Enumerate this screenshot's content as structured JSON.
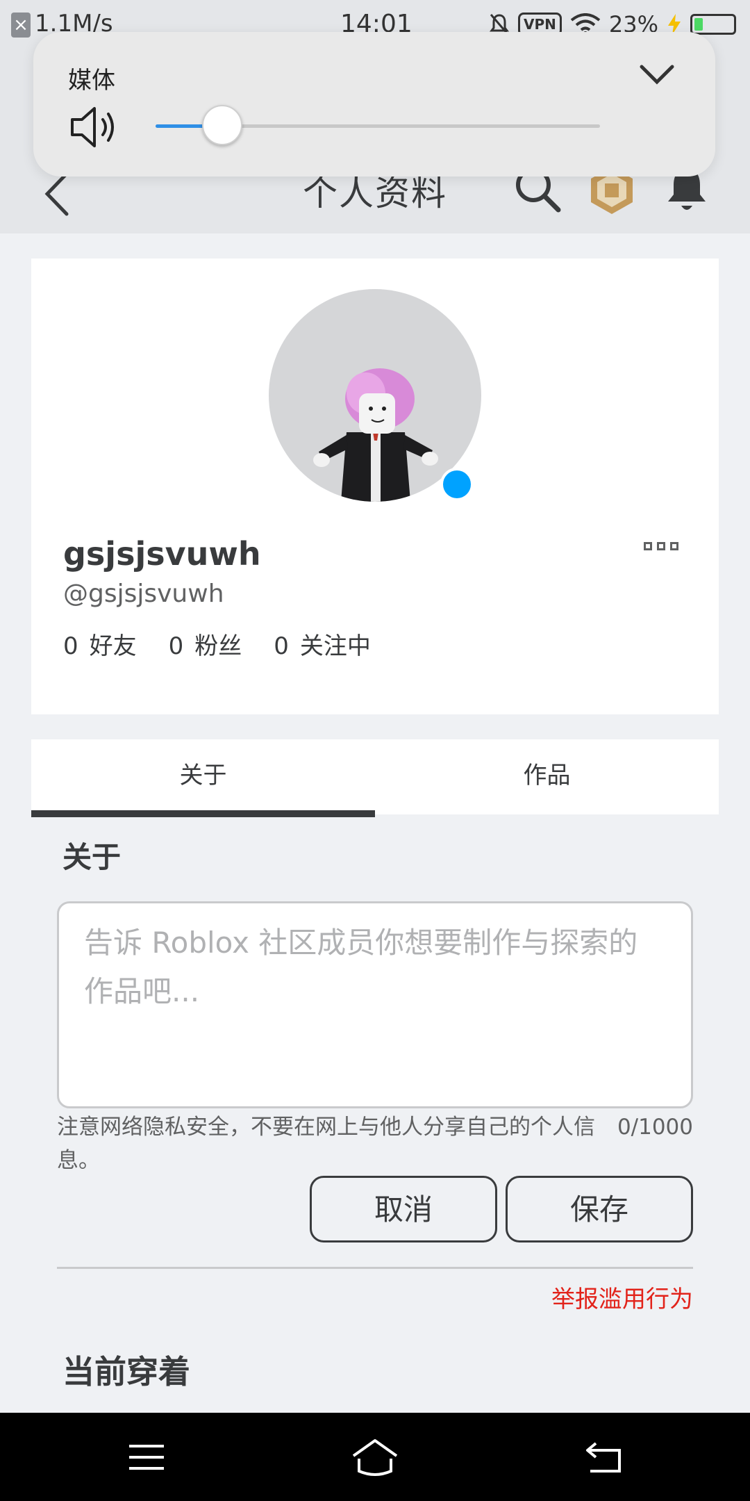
{
  "status_bar": {
    "speed": "1.1M/s",
    "time": "14:01",
    "vpn_label": "VPN",
    "battery_percent": "23%",
    "battery_level": 0.23,
    "icons": [
      "close-notification-icon",
      "mute-icon",
      "vpn-icon",
      "wifi-icon",
      "charging-icon",
      "battery-icon"
    ]
  },
  "media_overlay": {
    "label": "媒体",
    "volume_fraction": 0.15,
    "accent_color": "#2f8fe6"
  },
  "header": {
    "title": "个人资料",
    "icons": [
      "back-arrow-icon",
      "search-icon",
      "robux-icon",
      "bell-icon"
    ]
  },
  "profile": {
    "display_name": "gsjsjsvuwh",
    "username": "@gsjsjsvuwh",
    "status_color": "#00a2ff",
    "stats": [
      {
        "count": "0",
        "label": "好友"
      },
      {
        "count": "0",
        "label": "粉丝"
      },
      {
        "count": "0",
        "label": "关注中"
      }
    ]
  },
  "tabs": [
    {
      "label": "关于",
      "active": true
    },
    {
      "label": "作品",
      "active": false
    }
  ],
  "about": {
    "heading": "关于",
    "placeholder": "告诉 Roblox 社区成员你想要制作与探索的作品吧...",
    "value": "",
    "privacy_note": "注意网络隐私安全，不要在网上与他人分享自己的个人信息。",
    "char_count": "0/1000",
    "cancel_label": "取消",
    "save_label": "保存",
    "report_label": "举报滥用行为",
    "report_color": "#e2231a"
  },
  "currently_wearing": {
    "heading": "当前穿着"
  },
  "nav_bar": {
    "icons": [
      "menu-icon",
      "home-icon",
      "back-icon"
    ]
  }
}
